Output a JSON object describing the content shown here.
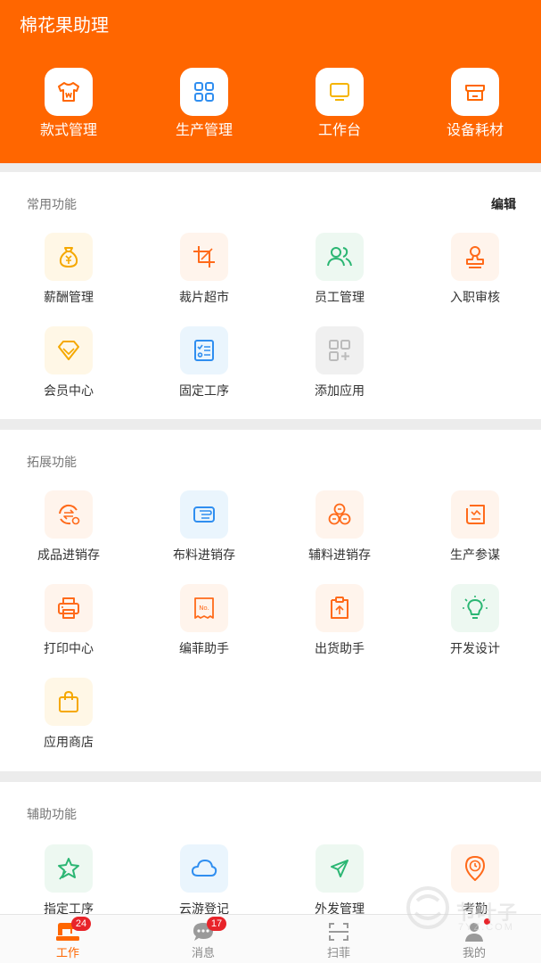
{
  "app": {
    "title": "棉花果助理"
  },
  "top_nav": [
    {
      "label": "款式管理",
      "icon": "shirt-icon"
    },
    {
      "label": "生产管理",
      "icon": "grid-icon"
    },
    {
      "label": "工作台",
      "icon": "monitor-icon"
    },
    {
      "label": "设备耗材",
      "icon": "store-icon"
    }
  ],
  "common": {
    "title": "常用功能",
    "edit_label": "编辑",
    "items": [
      {
        "label": "薪酬管理",
        "icon": "money-bag-icon"
      },
      {
        "label": "裁片超市",
        "icon": "crop-icon"
      },
      {
        "label": "员工管理",
        "icon": "users-icon"
      },
      {
        "label": "入职审核",
        "icon": "stamp-icon"
      },
      {
        "label": "会员中心",
        "icon": "diamond-icon"
      },
      {
        "label": "固定工序",
        "icon": "checklist-icon"
      },
      {
        "label": "添加应用",
        "icon": "add-app-icon"
      }
    ]
  },
  "extended": {
    "title": "拓展功能",
    "items": [
      {
        "label": "成品进销存",
        "icon": "exchange-icon"
      },
      {
        "label": "布料进销存",
        "icon": "fabric-icon"
      },
      {
        "label": "辅料进销存",
        "icon": "buttons-icon"
      },
      {
        "label": "生产参谋",
        "icon": "report-icon"
      },
      {
        "label": "打印中心",
        "icon": "printer-icon"
      },
      {
        "label": "编菲助手",
        "icon": "receipt-icon"
      },
      {
        "label": "出货助手",
        "icon": "shipping-box-icon"
      },
      {
        "label": "开发设计",
        "icon": "bulb-icon"
      },
      {
        "label": "应用商店",
        "icon": "shopping-bag-icon"
      }
    ]
  },
  "auxiliary": {
    "title": "辅助功能",
    "items": [
      {
        "label": "指定工序",
        "icon": "pin-icon"
      },
      {
        "label": "云游登记",
        "icon": "cloud-icon"
      },
      {
        "label": "外发管理",
        "icon": "send-icon"
      },
      {
        "label": "考勤",
        "icon": "clock-pin-icon"
      }
    ]
  },
  "tabbar": [
    {
      "label": "工作",
      "badge": "24",
      "active": true
    },
    {
      "label": "消息",
      "badge": "17",
      "active": false
    },
    {
      "label": "扫菲",
      "badge": "",
      "active": false
    },
    {
      "label": "我的",
      "badge": "",
      "active": false
    }
  ],
  "watermark": {
    "text": "节叶子",
    "sub": "7YZ.COM"
  },
  "colors": {
    "brand": "#ff6600",
    "badge": "#e8242a"
  }
}
